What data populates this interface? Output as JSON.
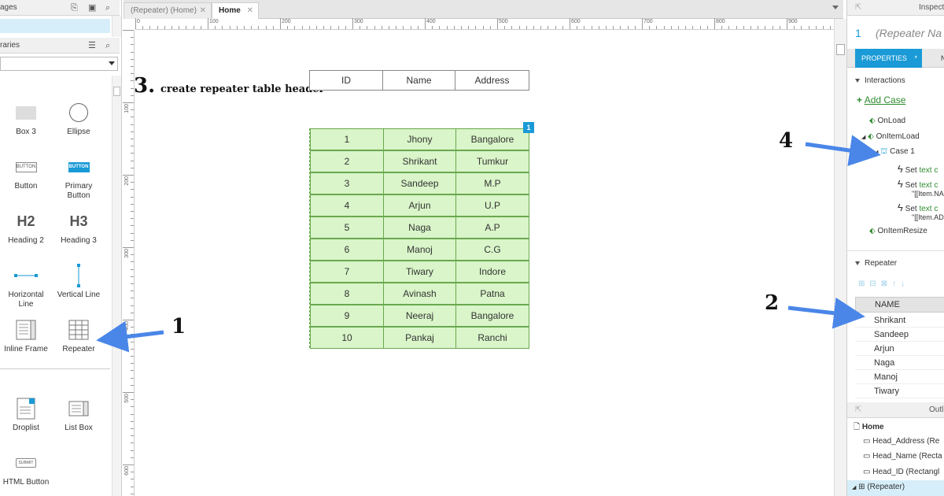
{
  "left": {
    "pages_title": "ages",
    "libraries_title": "raries",
    "widgets": [
      {
        "name": "box3",
        "label": "Box 3"
      },
      {
        "name": "ellipse",
        "label": "Ellipse"
      },
      {
        "name": "button",
        "label": "Button",
        "icon_text": "BUTTON"
      },
      {
        "name": "primary-button",
        "label": "Primary Button",
        "icon_text": "BUTTON"
      },
      {
        "name": "heading2",
        "label": "Heading 2",
        "icon_text": "H2"
      },
      {
        "name": "heading3",
        "label": "Heading 3",
        "icon_text": "H3"
      },
      {
        "name": "horizontal-line",
        "label": "Horizontal Line"
      },
      {
        "name": "vertical-line",
        "label": "Vertical Line"
      },
      {
        "name": "inline-frame",
        "label": "Inline Frame"
      },
      {
        "name": "repeater",
        "label": "Repeater"
      },
      {
        "name": "droplist",
        "label": "Droplist"
      },
      {
        "name": "list-box",
        "label": "List Box"
      },
      {
        "name": "html-button",
        "label": "HTML Button",
        "icon_text": "SUBMIT"
      }
    ]
  },
  "tabs": [
    {
      "label": "(Repeater) (Home)",
      "active": false
    },
    {
      "label": "Home",
      "active": true
    }
  ],
  "ruler_h": [
    "0",
    "100",
    "200",
    "300",
    "400",
    "500",
    "600",
    "700",
    "800",
    "900"
  ],
  "ruler_v": [
    "100",
    "200",
    "300",
    "400",
    "500",
    "600"
  ],
  "header_cells": [
    "ID",
    "Name",
    "Address"
  ],
  "rows": [
    [
      "1",
      "Jhony",
      "Bangalore"
    ],
    [
      "2",
      "Shrikant",
      "Tumkur"
    ],
    [
      "3",
      "Sandeep",
      "M.P"
    ],
    [
      "4",
      "Arjun",
      "U.P"
    ],
    [
      "5",
      "Naga",
      "A.P"
    ],
    [
      "6",
      "Manoj",
      "C.G"
    ],
    [
      "7",
      "Tiwary",
      "Indore"
    ],
    [
      "8",
      "Avinash",
      "Patna"
    ],
    [
      "9",
      "Neeraj",
      "Bangalore"
    ],
    [
      "10",
      "Pankaj",
      "Ranchi"
    ]
  ],
  "badge": "1",
  "annotations": {
    "step3_num": "3.",
    "step3_text": "create repeater table header",
    "n1": "1",
    "n2": "2",
    "n4": "4"
  },
  "right": {
    "inspector_title": "Inspect",
    "widget_num": "1",
    "widget_name": "(Repeater Na",
    "tab_properties": "PROPERTIES",
    "tab_star": "*",
    "tab_other": "N",
    "interactions": "Interactions",
    "add_case": "Add Case",
    "events": [
      "OnLoad",
      "OnItemLoad",
      "Case 1",
      "OnItemResize"
    ],
    "actions": [
      {
        "set": "Set",
        "rest": "text c",
        "sub": ""
      },
      {
        "set": "Set",
        "rest": "text c",
        "sub": "\"[[Item.NA"
      },
      {
        "set": "Set",
        "rest": "text c",
        "sub": "\"[[Item.AD"
      }
    ],
    "repeater_label": "Repeater",
    "grid_header": "NAME",
    "grid_rows": [
      "Shrikant",
      "Sandeep",
      "Arjun",
      "Naga",
      "Manoj",
      "Tiwary"
    ],
    "outline_title": "Outl",
    "outline_items": [
      "Home",
      "Head_Address (Re",
      "Head_Name (Recta",
      "Head_ID (Rectangl",
      "(Repeater)"
    ]
  },
  "colors": {
    "accent": "#1a9ad6",
    "arrow": "#4a86e8",
    "row_fill": "#d9f5c9",
    "row_border": "#6aa84f",
    "badge": "#1a9ad6"
  }
}
